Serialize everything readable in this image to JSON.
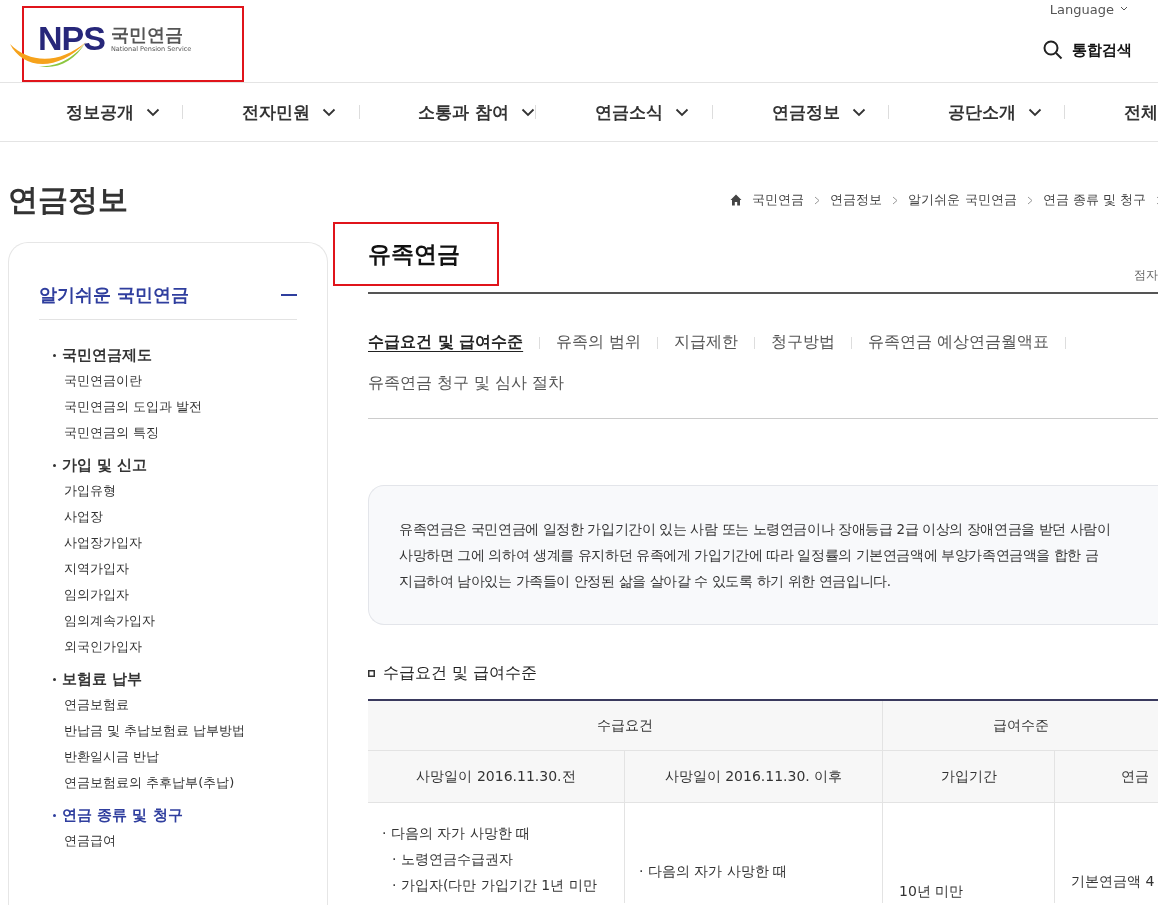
{
  "logo": {
    "mark": "NPS",
    "name": "국민연금",
    "subtitle": "National Pension Service"
  },
  "utility": {
    "language": "Language",
    "search": "통합검색"
  },
  "nav": [
    {
      "label": "정보공개",
      "has_menu": true
    },
    {
      "label": "전자민원",
      "has_menu": true
    },
    {
      "label": "소통과 참여",
      "has_menu": true
    },
    {
      "label": "연금소식",
      "has_menu": true
    },
    {
      "label": "연금정보",
      "has_menu": true
    },
    {
      "label": "공단소개",
      "has_menu": true
    },
    {
      "label": "전체",
      "has_menu": false
    }
  ],
  "page_title": "연금정보",
  "breadcrumb": [
    "국민연금",
    "연금정보",
    "알기쉬운 국민연금",
    "연금 종류 및 청구"
  ],
  "sidebar": {
    "title": "알기쉬운 국민연금",
    "expanded": true,
    "sections": [
      {
        "label": "국민연금제도",
        "selected": false,
        "children": [
          {
            "label": "국민연금이란",
            "selected": false
          },
          {
            "label": "국민연금의 도입과 발전",
            "selected": false
          },
          {
            "label": "국민연금의 특징",
            "selected": false
          }
        ]
      },
      {
        "label": "가입 및 신고",
        "selected": false,
        "children": [
          {
            "label": "가입유형",
            "selected": false
          },
          {
            "label": "사업장",
            "selected": false
          },
          {
            "label": "사업장가입자",
            "selected": false
          },
          {
            "label": "지역가입자",
            "selected": false
          },
          {
            "label": "임의가입자",
            "selected": false
          },
          {
            "label": "임의계속가입자",
            "selected": false
          },
          {
            "label": "외국인가입자",
            "selected": false
          }
        ]
      },
      {
        "label": "보험료 납부",
        "selected": false,
        "children": [
          {
            "label": "연금보험료",
            "selected": false
          },
          {
            "label": "반납금 및 추납보험료 납부방법",
            "selected": false
          },
          {
            "label": "반환일시금 반납",
            "selected": false
          },
          {
            "label": "연금보험료의 추후납부(추납)",
            "selected": false
          }
        ]
      },
      {
        "label": "연금 종류 및 청구",
        "selected": true,
        "children": [
          {
            "label": "연금급여",
            "selected": false
          }
        ]
      }
    ]
  },
  "content": {
    "title": "유족연금",
    "braille": "점자",
    "tabs": [
      {
        "label": "수급요건 및 급여수준",
        "selected": true
      },
      {
        "label": "유족의 범위",
        "selected": false
      },
      {
        "label": "지급제한",
        "selected": false
      },
      {
        "label": "청구방법",
        "selected": false
      },
      {
        "label": "유족연금 예상연금월액표",
        "selected": false
      },
      {
        "label": "유족연금 청구 및 심사 절차",
        "selected": false
      }
    ],
    "intro": [
      "유족연금은 국민연금에 일정한 가입기간이 있는 사람 또는 노령연금이나 장애등급 2급 이상의 장애연금을 받던 사람이",
      "사망하면 그에 의하여 생계를 유지하던 유족에게 가입기간에 따라 일정률의 기본연금액에 부양가족연금액을 합한 금",
      "지급하여 남아있는 가족들이 안정된 삶을 살아갈 수 있도록 하기 위한 연금입니다."
    ],
    "section_heading": "수급요건 및 급여수준",
    "table": {
      "group_headers": [
        "수급요건",
        "급여수준"
      ],
      "columns": [
        "사망일이 2016.11.30.전",
        "사망일이 2016.11.30. 이후",
        "가입기간",
        "연금"
      ],
      "rows": [
        {
          "cells": [
            [
              {
                "text": "· 다음의 자가 사망한 때",
                "children": [
                  {
                    "text": "· 노령연금수급권자"
                  },
                  {
                    "text": "· 가입자(다만 가입기간 1년 미만"
                  }
                ]
              }
            ],
            [
              {
                "text": "· 다음의 자가 사망한 때"
              }
            ],
            [
              {
                "text": "10년 미만"
              }
            ],
            [
              {
                "text": "기본연금액 4"
              }
            ]
          ]
        }
      ]
    }
  }
}
